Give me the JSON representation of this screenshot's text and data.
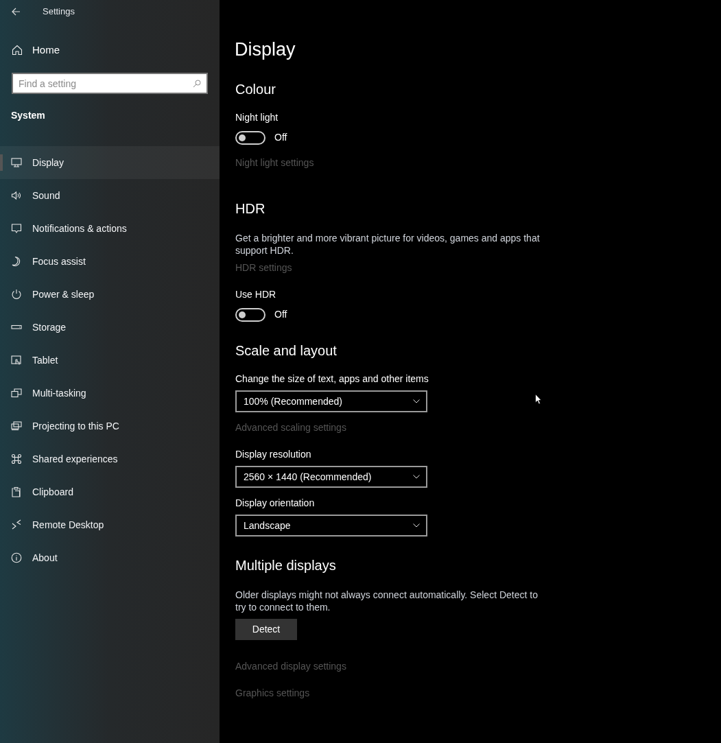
{
  "window": {
    "title": "Settings"
  },
  "home": {
    "label": "Home"
  },
  "search": {
    "placeholder": "Find a setting"
  },
  "sidebar": {
    "section": "System",
    "items": [
      {
        "label": "Display",
        "selected": true
      },
      {
        "label": "Sound",
        "selected": false
      },
      {
        "label": "Notifications & actions",
        "selected": false
      },
      {
        "label": "Focus assist",
        "selected": false
      },
      {
        "label": "Power & sleep",
        "selected": false
      },
      {
        "label": "Storage",
        "selected": false
      },
      {
        "label": "Tablet",
        "selected": false
      },
      {
        "label": "Multi-tasking",
        "selected": false
      },
      {
        "label": "Projecting to this PC",
        "selected": false
      },
      {
        "label": "Shared experiences",
        "selected": false
      },
      {
        "label": "Clipboard",
        "selected": false
      },
      {
        "label": "Remote Desktop",
        "selected": false
      },
      {
        "label": "About",
        "selected": false
      }
    ]
  },
  "page": {
    "title": "Display",
    "items": [
      {
        "kind": "heading",
        "text": "Colour"
      },
      {
        "kind": "label",
        "text": "Night light"
      },
      {
        "kind": "toggle",
        "on": false,
        "text": "Off"
      },
      {
        "kind": "link",
        "text": "Night light settings",
        "disabled": true
      },
      {
        "kind": "heading",
        "text": "HDR"
      },
      {
        "kind": "text",
        "text": "Get a brighter and more vibrant picture for videos, games and apps that support HDR."
      },
      {
        "kind": "link",
        "text": "HDR settings",
        "disabled": true
      },
      {
        "kind": "label",
        "text": "Use HDR"
      },
      {
        "kind": "toggle",
        "on": false,
        "text": "Off"
      },
      {
        "kind": "heading",
        "text": "Scale and layout"
      },
      {
        "kind": "label",
        "text": "Change the size of text, apps and other items"
      },
      {
        "kind": "dropdown",
        "value": "100% (Recommended)"
      },
      {
        "kind": "link",
        "text": "Advanced scaling settings",
        "disabled": true
      },
      {
        "kind": "label",
        "text": "Display resolution"
      },
      {
        "kind": "dropdown",
        "value": "2560 × 1440 (Recommended)"
      },
      {
        "kind": "label",
        "text": "Display orientation"
      },
      {
        "kind": "dropdown",
        "value": "Landscape"
      },
      {
        "kind": "heading",
        "text": "Multiple displays"
      },
      {
        "kind": "text",
        "text": "Older displays might not always connect automatically. Select Detect to try to connect to them."
      },
      {
        "kind": "button",
        "text": "Detect"
      },
      {
        "kind": "link",
        "text": "Advanced display settings",
        "disabled": true
      },
      {
        "kind": "link",
        "text": "Graphics settings",
        "disabled": true
      }
    ]
  }
}
